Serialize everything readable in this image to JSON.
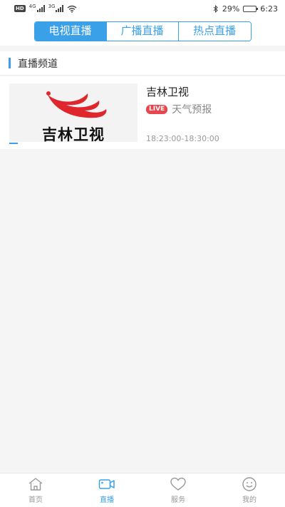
{
  "status_bar": {
    "hd": "HD",
    "net1": "4G",
    "net2": "3G",
    "battery_percent": "29%",
    "battery_level": 0.29,
    "time": "6:23"
  },
  "header": {
    "tabs": [
      {
        "label": "电视直播",
        "active": true
      },
      {
        "label": "广播直播",
        "active": false
      },
      {
        "label": "热点直播",
        "active": false
      }
    ]
  },
  "section": {
    "title": "直播频道"
  },
  "channels": [
    {
      "thumbnail_text": "吉林卫视",
      "name": "吉林卫视",
      "live_badge": "LIVE",
      "program": "天气预报",
      "time_range": "18:23:00-18:30:00"
    }
  ],
  "bottom_nav": {
    "items": [
      {
        "label": "首页",
        "icon": "home-icon",
        "active": false
      },
      {
        "label": "直播",
        "icon": "video-camera-icon",
        "active": true
      },
      {
        "label": "服务",
        "icon": "heart-icon",
        "active": false
      },
      {
        "label": "我的",
        "icon": "smiley-icon",
        "active": false
      }
    ]
  },
  "colors": {
    "accent": "#3aa0e8",
    "live_badge": "#e8454d",
    "logo_red": "#e0262d"
  }
}
